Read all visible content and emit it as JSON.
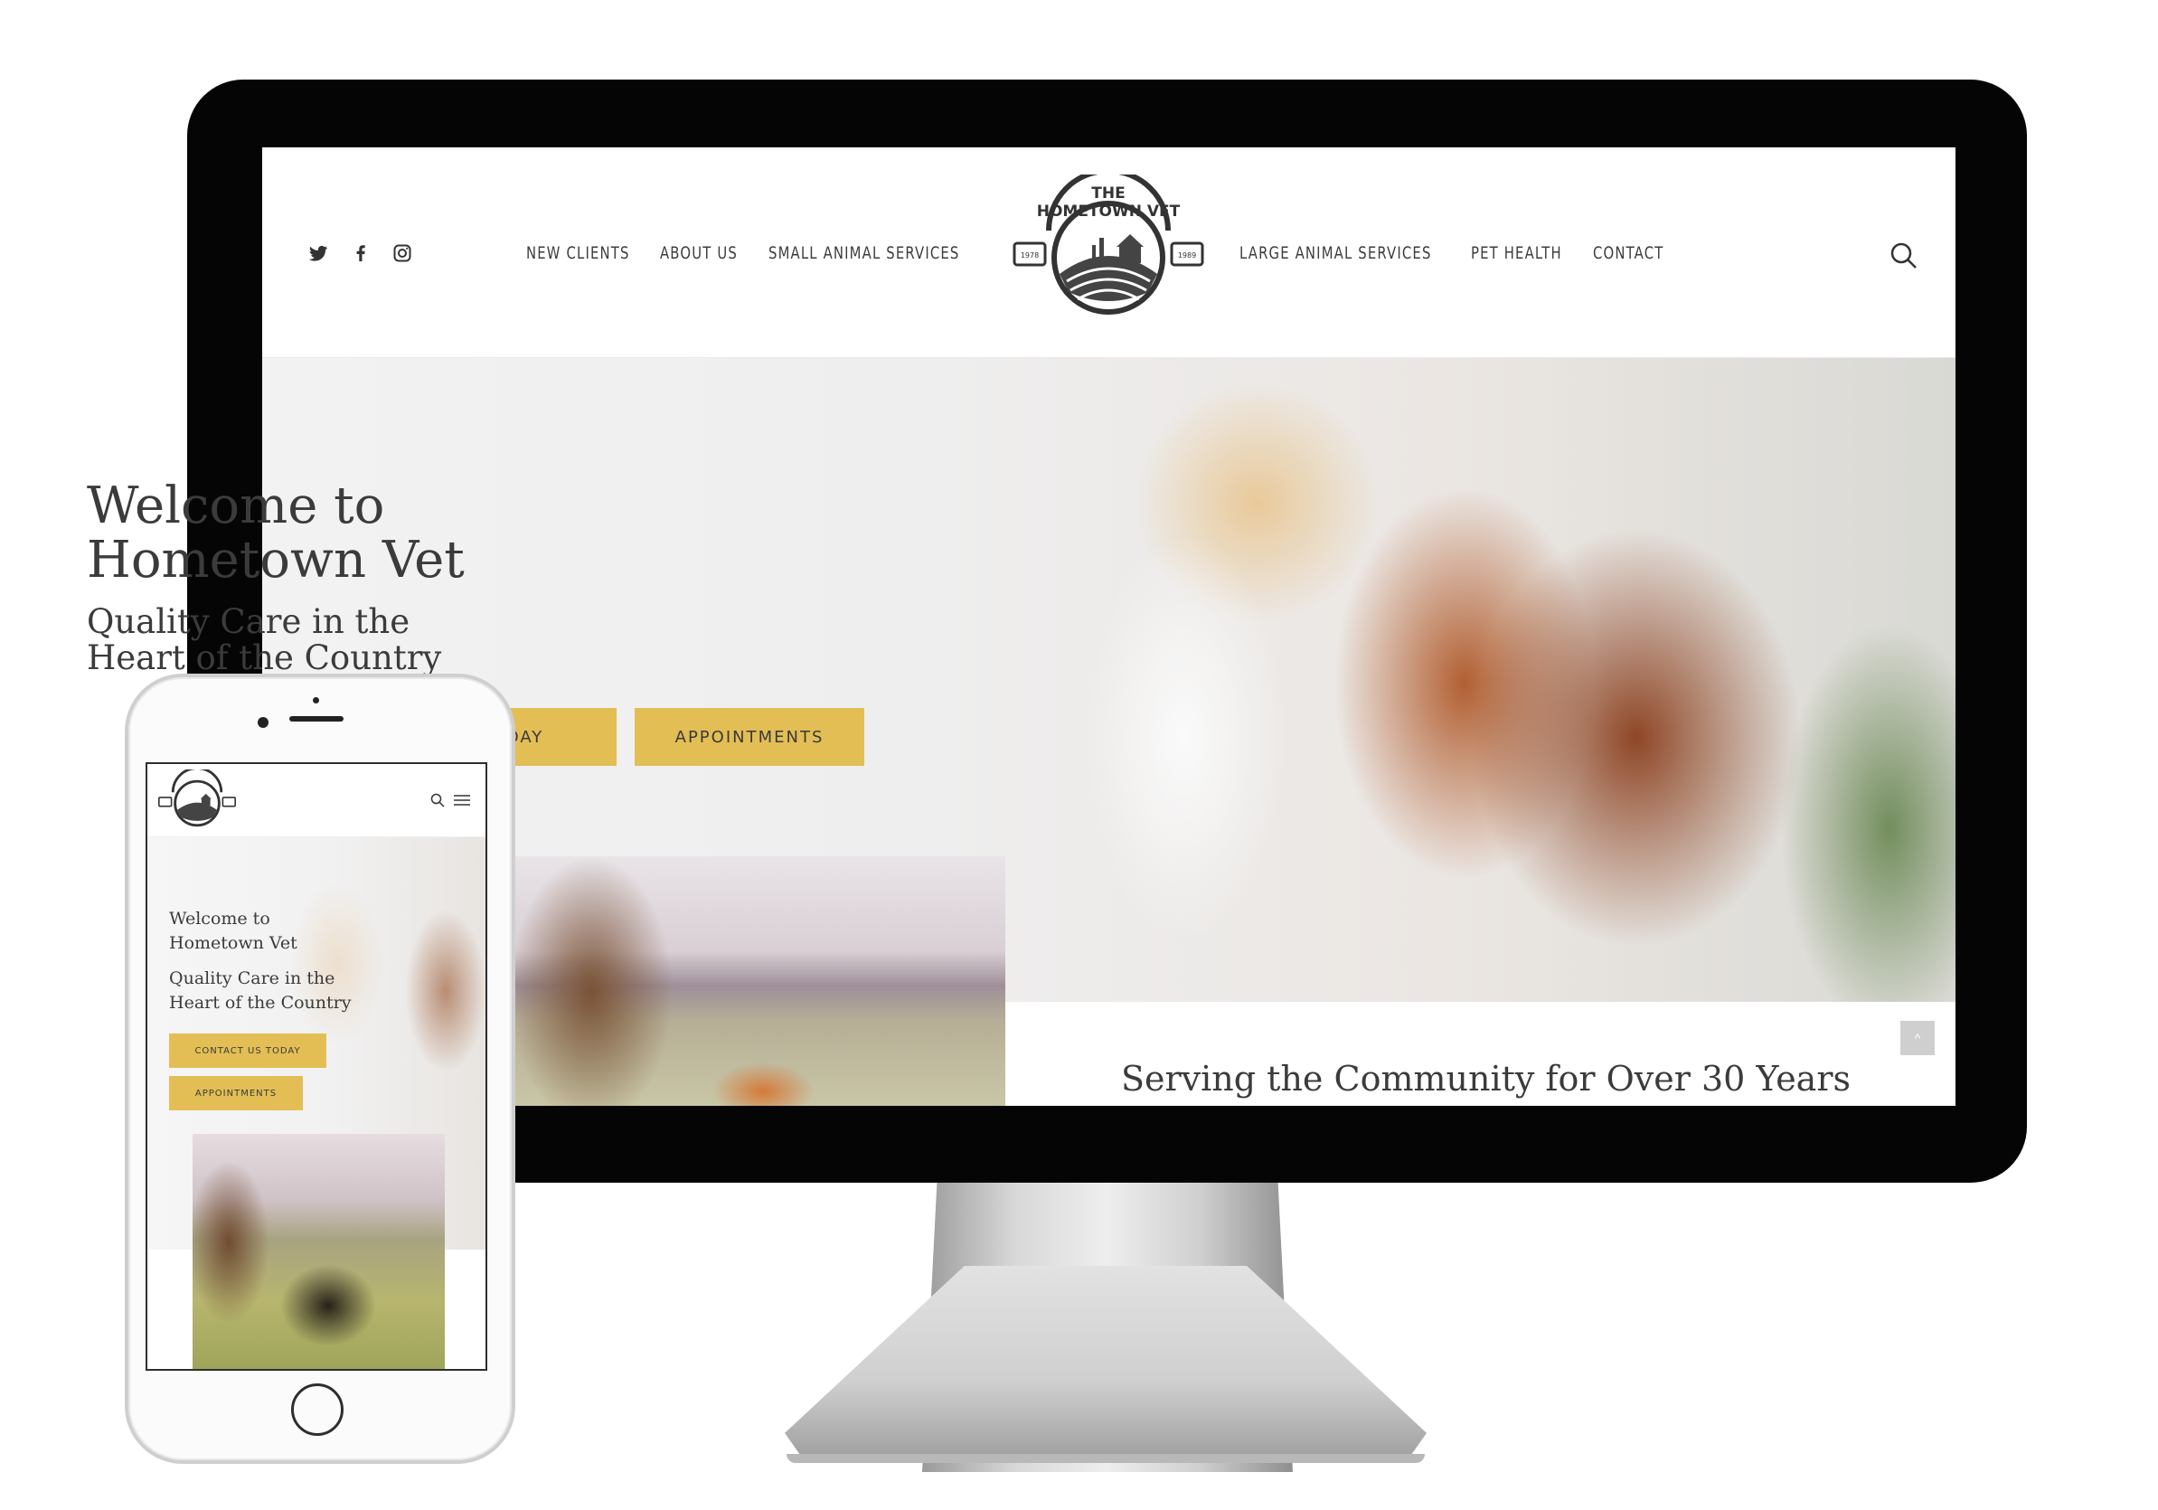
{
  "desktop": {
    "header": {
      "social": [
        "twitter-icon",
        "facebook-icon",
        "instagram-icon"
      ],
      "nav_left": [
        "NEW CLIENTS",
        "ABOUT US",
        "SMALL ANIMAL SERVICES"
      ],
      "nav_right": [
        "LARGE ANIMAL SERVICES",
        "PET HEALTH",
        "CONTACT"
      ],
      "logo": {
        "top": "THE",
        "main": "HOMETOWN VET",
        "left_year": "1978",
        "right_year": "1989"
      }
    },
    "hero": {
      "title_line1": "Welcome to",
      "title_line2": "Hometown Vet",
      "subtitle_line1": "Quality Care in the",
      "subtitle_line2": "Heart of the Country",
      "button_contact": "TODAY",
      "button_appointments": "APPOINTMENTS"
    },
    "section_heading": "Serving the Community for Over 30 Years",
    "scroll_top_icon": "^"
  },
  "mobile": {
    "hero": {
      "title_line1": "Welcome to",
      "title_line2": "Hometown Vet",
      "subtitle_line1": "Quality Care in the",
      "subtitle_line2": "Heart of the Country",
      "button_contact": "CONTACT US TODAY",
      "button_appointments": "APPOINTMENTS"
    }
  },
  "colors": {
    "accent": "#e2be55",
    "text": "#3b3b3b",
    "bezel": "#050505"
  }
}
